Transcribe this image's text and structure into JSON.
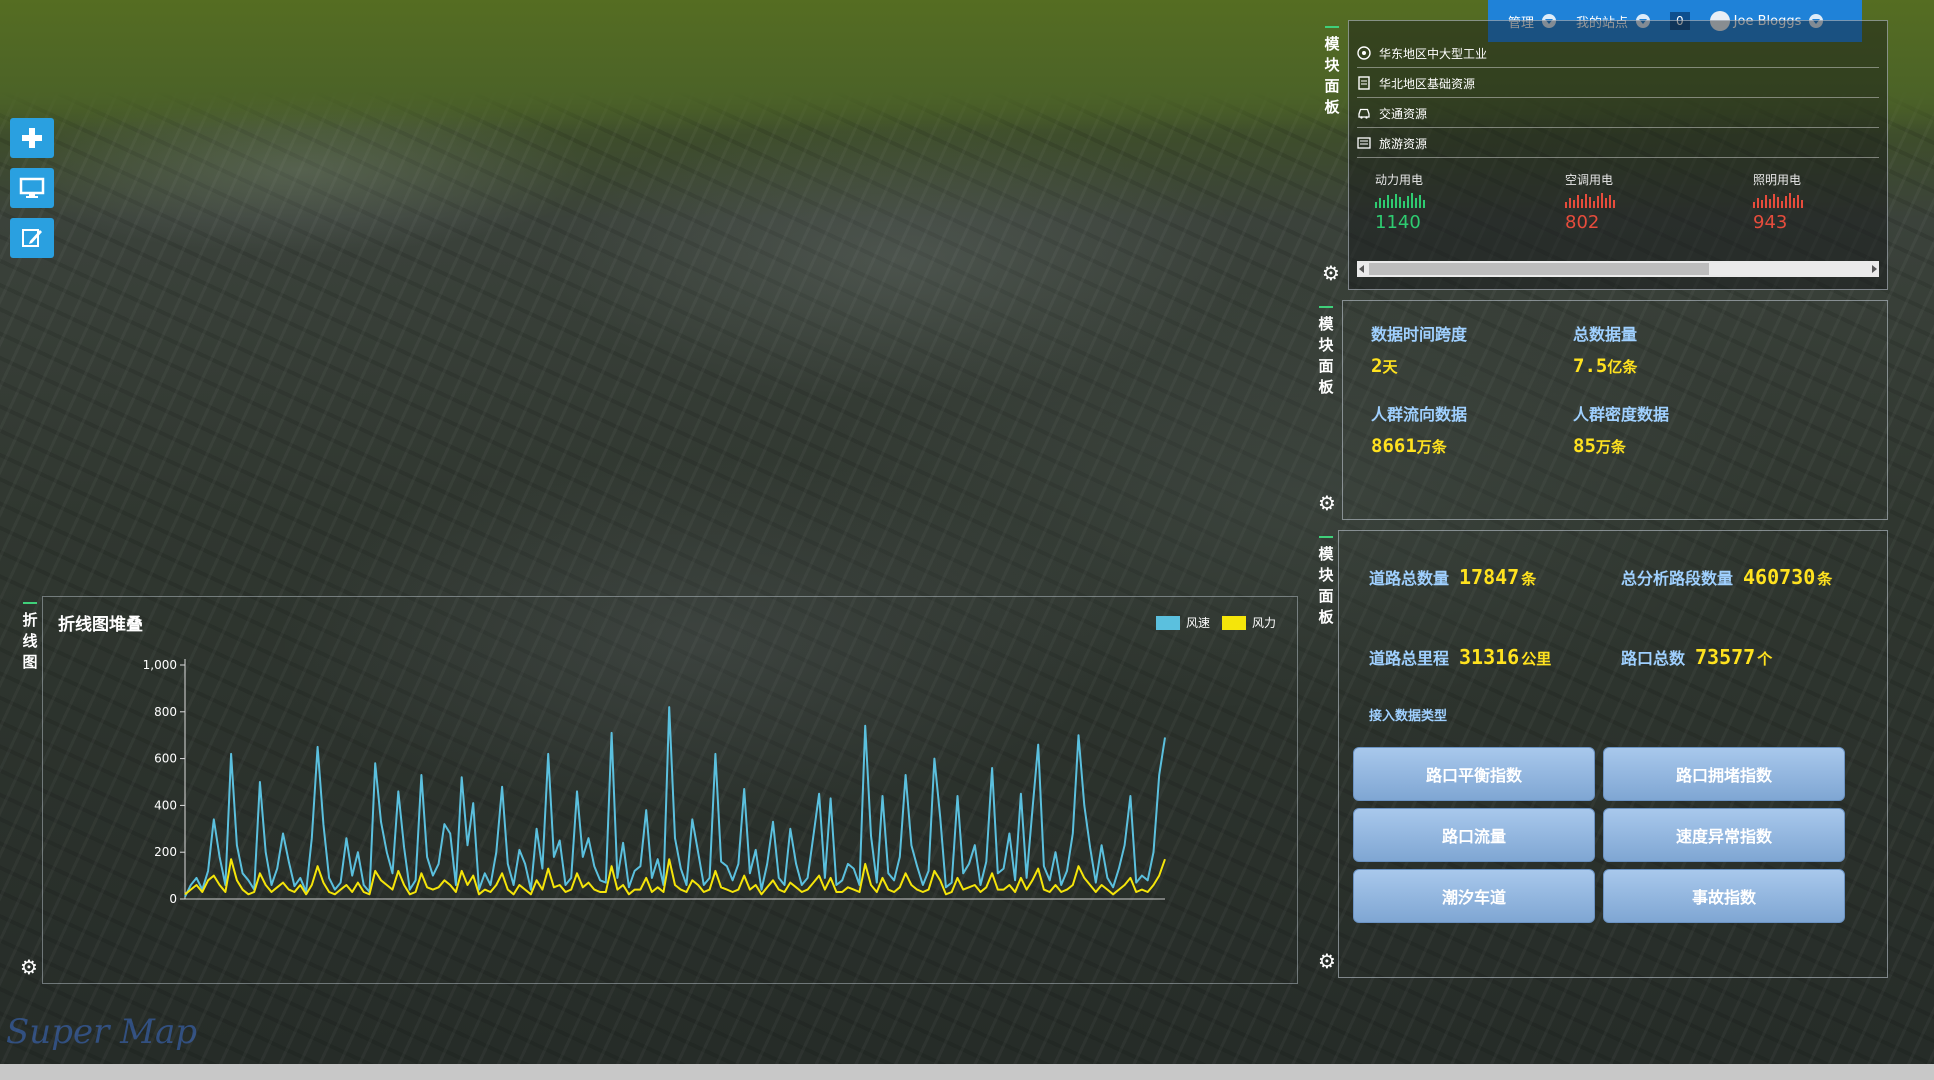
{
  "topbar": {
    "manage_label": "管理",
    "my_site_label": "我的站点",
    "notification_count": "0",
    "user_name": "Joe Bloggs"
  },
  "side_tab_label": "模块面板",
  "chart_tab_label": "折线图",
  "resources": [
    {
      "label": "华东地区中大型工业",
      "icon": "target-icon"
    },
    {
      "label": "华北地区基础资源",
      "icon": "document-icon"
    },
    {
      "label": "交通资源",
      "icon": "car-icon"
    },
    {
      "label": "旅游资源",
      "icon": "list-icon"
    }
  ],
  "meters": [
    {
      "label": "动力用电",
      "value": "1140",
      "color": "#2ecc71"
    },
    {
      "label": "空调用电",
      "value": "802",
      "color": "#e74c3c"
    },
    {
      "label": "照明用电",
      "value": "943",
      "color": "#e74c3c"
    }
  ],
  "stats": {
    "time_span_label": "数据时间跨度",
    "time_span_value": "2",
    "time_span_unit": "天",
    "total_label": "总数据量",
    "total_value": "7.5",
    "total_unit": "亿条",
    "flow_label": "人群流向数据",
    "flow_value": "8661",
    "flow_unit": "万条",
    "density_label": "人群密度数据",
    "density_value": "85",
    "density_unit": "万条"
  },
  "road": {
    "count_label": "道路总数量",
    "count_value": "17847",
    "count_unit": "条",
    "segments_label": "总分析路段数量",
    "segments_value": "460730",
    "segments_unit": "条",
    "mileage_label": "道路总里程",
    "mileage_value": "31316",
    "mileage_unit": "公里",
    "junctions_label": "路口总数",
    "junctions_value": "73577",
    "junctions_unit": "个",
    "data_type_label": "接入数据类型"
  },
  "index_buttons": [
    "路口平衡指数",
    "路口拥堵指数",
    "路口流量",
    "速度异常指数",
    "潮汐车道",
    "事故指数"
  ],
  "chart_data": {
    "type": "line",
    "title": "折线图堆叠",
    "ylim": [
      0,
      1000
    ],
    "yticks": [
      "0",
      "200",
      "400",
      "600",
      "800",
      "1,000"
    ],
    "legend": [
      "风速",
      "风力"
    ],
    "colors": {
      "风速": "#5bc0de",
      "风力": "#f5e50a"
    },
    "series": [
      {
        "name": "风速",
        "values": [
          10,
          60,
          90,
          40,
          120,
          340,
          180,
          60,
          620,
          230,
          110,
          80,
          40,
          500,
          200,
          60,
          130,
          280,
          160,
          55,
          90,
          30,
          260,
          650,
          320,
          90,
          40,
          70,
          260,
          100,
          200,
          60,
          30,
          580,
          330,
          200,
          110,
          460,
          220,
          40,
          80,
          530,
          180,
          100,
          150,
          320,
          280,
          60,
          520,
          230,
          410,
          40,
          110,
          60,
          200,
          480,
          150,
          60,
          210,
          150,
          40,
          300,
          130,
          620,
          180,
          250,
          60,
          90,
          460,
          180,
          260,
          140,
          80,
          70,
          710,
          90,
          240,
          50,
          120,
          140,
          380,
          90,
          170,
          60,
          820,
          260,
          130,
          60,
          340,
          200,
          60,
          90,
          620,
          160,
          140,
          80,
          150,
          470,
          110,
          210,
          40,
          150,
          330,
          90,
          60,
          300,
          150,
          60,
          90,
          270,
          450,
          90,
          430,
          60,
          80,
          150,
          130,
          60,
          740,
          270,
          70,
          440,
          110,
          80,
          180,
          530,
          230,
          140,
          60,
          120,
          600,
          350,
          50,
          70,
          440,
          110,
          150,
          230,
          60,
          160,
          560,
          110,
          130,
          280,
          80,
          450,
          90,
          380,
          660,
          140,
          80,
          200,
          60,
          120,
          280,
          700,
          400,
          220,
          70,
          230,
          90,
          50,
          130,
          230,
          440,
          70,
          100,
          80,
          200,
          530,
          690
        ]
      },
      {
        "name": "风力",
        "values": [
          20,
          40,
          60,
          30,
          80,
          100,
          60,
          30,
          170,
          80,
          40,
          20,
          30,
          110,
          60,
          30,
          50,
          70,
          40,
          30,
          60,
          20,
          60,
          140,
          70,
          30,
          20,
          40,
          60,
          30,
          70,
          30,
          20,
          120,
          80,
          60,
          40,
          120,
          60,
          20,
          30,
          110,
          50,
          40,
          50,
          80,
          60,
          30,
          120,
          60,
          100,
          20,
          40,
          30,
          60,
          110,
          40,
          20,
          60,
          40,
          20,
          80,
          40,
          130,
          50,
          60,
          30,
          40,
          110,
          50,
          70,
          40,
          30,
          30,
          140,
          40,
          60,
          20,
          40,
          40,
          90,
          30,
          50,
          30,
          170,
          60,
          40,
          30,
          80,
          60,
          30,
          40,
          120,
          50,
          40,
          30,
          40,
          100,
          40,
          60,
          20,
          50,
          80,
          40,
          30,
          70,
          50,
          30,
          40,
          70,
          100,
          40,
          90,
          30,
          30,
          50,
          40,
          30,
          150,
          60,
          30,
          90,
          40,
          30,
          50,
          110,
          60,
          40,
          30,
          40,
          120,
          80,
          20,
          30,
          90,
          40,
          50,
          60,
          30,
          50,
          110,
          40,
          40,
          60,
          30,
          90,
          40,
          80,
          130,
          40,
          30,
          60,
          30,
          40,
          60,
          140,
          90,
          60,
          30,
          60,
          40,
          20,
          40,
          60,
          90,
          30,
          40,
          30,
          60,
          100,
          170
        ]
      }
    ]
  }
}
